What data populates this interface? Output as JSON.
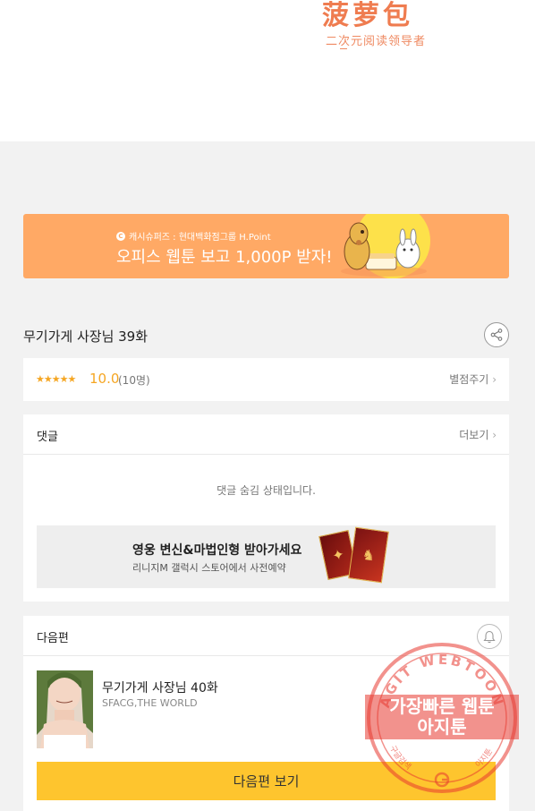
{
  "logo": {
    "main": "菠萝包",
    "sub": "二次元阅读领导者"
  },
  "banner": {
    "small_text": "캐시슈퍼즈 : 현대백화점그룹 H.Point",
    "main_text": "오피스 웹툰 보고 1,000P 받자!"
  },
  "episode": {
    "title": "무기가게 사장님 39화"
  },
  "rating": {
    "stars": "★★★★★",
    "score": "10.0",
    "count": "(10명)",
    "rate_link": "별점주기"
  },
  "comments": {
    "header": "댓글",
    "more": "더보기",
    "hidden_message": "댓글 숨김 상태입니다."
  },
  "ad": {
    "title": "영웅 변신&마법인형 받아가세요",
    "subtitle": "리니지M 갤럭시 스토어에서 사전예약"
  },
  "next": {
    "header": "다음편",
    "title": "무기가게 사장님 40화",
    "author": "SFACG,THE WORLD",
    "button": "다음편 보기"
  },
  "stamp": {
    "ring_top": "AGIT WEBTOON",
    "line1": "가장빠른 웹툰",
    "line2": "아지툰",
    "ring_left": "구글검색",
    "ring_right": "아지툰"
  },
  "colors": {
    "banner": "#ffa965",
    "accent_star": "#f5a623",
    "next_button": "#fec52e",
    "stamp": "#e8392f"
  }
}
